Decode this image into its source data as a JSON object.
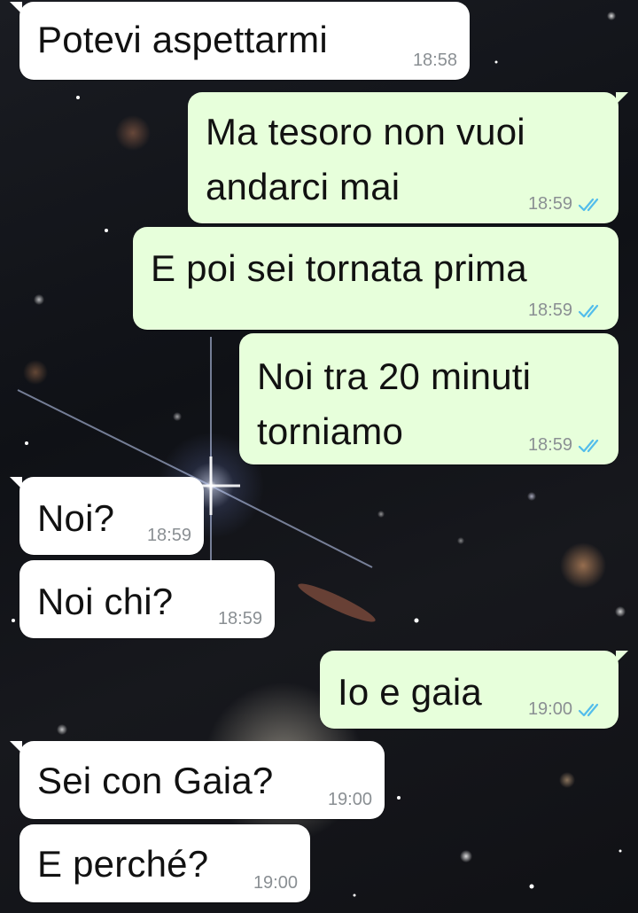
{
  "colors": {
    "incoming_bubble": "#ffffff",
    "outgoing_bubble": "#e7ffdb",
    "read_ticks": "#53bdeb"
  },
  "icons": {
    "read_receipt": "double-check-icon"
  },
  "messages": [
    {
      "direction": "incoming",
      "text": "Potevi aspettarmi",
      "time": "18:58"
    },
    {
      "direction": "outgoing",
      "text": "Ma tesoro non vuoi\nandarci mai",
      "time": "18:59",
      "status": "read"
    },
    {
      "direction": "outgoing",
      "text": "E poi sei tornata prima",
      "time": "18:59",
      "status": "read"
    },
    {
      "direction": "outgoing",
      "text": "Noi tra 20 minuti\ntorniamo",
      "time": "18:59",
      "status": "read"
    },
    {
      "direction": "incoming",
      "text": "Noi?",
      "time": "18:59"
    },
    {
      "direction": "incoming",
      "text": "Noi chi?",
      "time": "18:59"
    },
    {
      "direction": "outgoing",
      "text": "Io e gaia",
      "time": "19:00",
      "status": "read"
    },
    {
      "direction": "incoming",
      "text": "Sei con Gaia?",
      "time": "19:00"
    },
    {
      "direction": "incoming",
      "text": "E perché?",
      "time": "19:00"
    }
  ]
}
